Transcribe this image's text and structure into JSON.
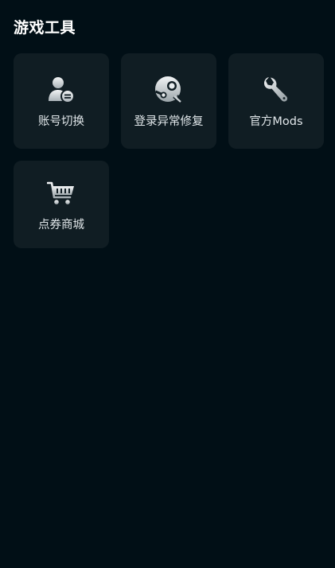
{
  "section": {
    "title": "游戏工具"
  },
  "tools": [
    {
      "label": "账号切换",
      "icon": "account-switch-icon"
    },
    {
      "label": "登录异常修复",
      "icon": "steam-repair-icon"
    },
    {
      "label": "官方Mods",
      "icon": "wrench-icon"
    },
    {
      "label": "点券商城",
      "icon": "shopping-cart-icon"
    }
  ],
  "colors": {
    "background": "#010f16",
    "tile": "#101d23",
    "text": "#e0e6e9",
    "icon": "#d9dfe2"
  }
}
